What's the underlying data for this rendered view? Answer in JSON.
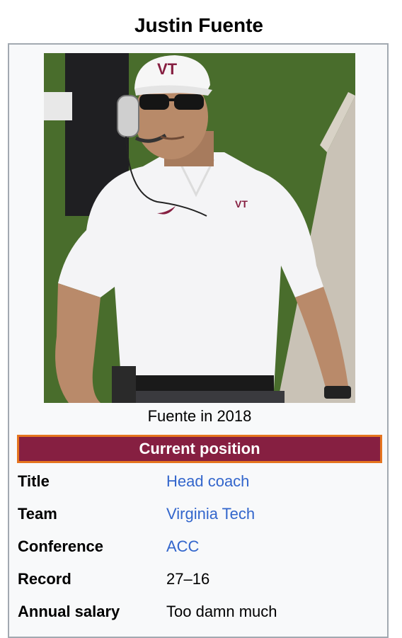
{
  "infobox": {
    "title": "Justin Fuente",
    "image": {
      "subject": "coach-photo",
      "caption": "Fuente in 2018"
    },
    "section_header": "Current position",
    "section_colors": {
      "background": "#861f41",
      "border": "#e5751f",
      "text": "#ffffff"
    },
    "link_color": "#3366cc",
    "rows": [
      {
        "label": "Title",
        "value": "Head coach",
        "is_link": true
      },
      {
        "label": "Team",
        "value": "Virginia Tech",
        "is_link": true
      },
      {
        "label": "Conference",
        "value": "ACC",
        "is_link": true
      },
      {
        "label": "Record",
        "value": "27–16",
        "is_link": false
      },
      {
        "label": "Annual salary",
        "value": "Too damn much",
        "is_link": false
      }
    ]
  }
}
